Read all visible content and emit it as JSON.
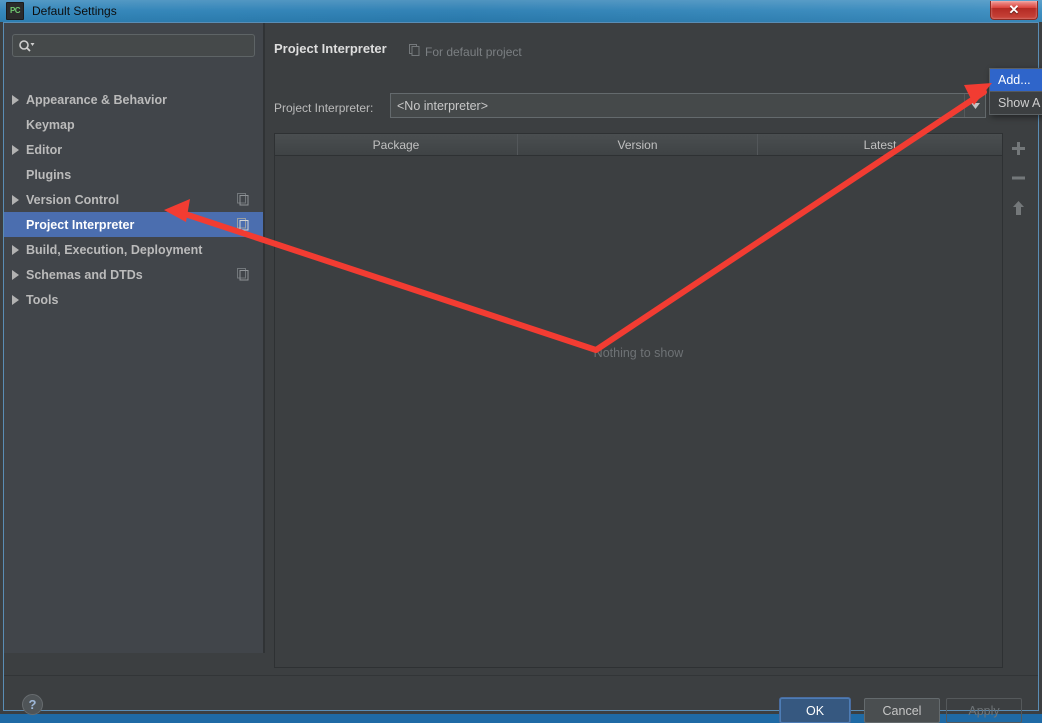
{
  "window": {
    "title": "Default Settings",
    "app_icon": "PC",
    "close_label": "✕"
  },
  "search": {
    "value": "",
    "placeholder": "",
    "icon": "search-icon"
  },
  "sidebar": {
    "items": [
      {
        "label": "Appearance & Behavior",
        "expandable": true,
        "selected": false,
        "has_copy_icon": false
      },
      {
        "label": "Keymap",
        "expandable": false,
        "selected": false,
        "has_copy_icon": false
      },
      {
        "label": "Editor",
        "expandable": true,
        "selected": false,
        "has_copy_icon": false
      },
      {
        "label": "Plugins",
        "expandable": false,
        "selected": false,
        "has_copy_icon": false
      },
      {
        "label": "Version Control",
        "expandable": true,
        "selected": false,
        "has_copy_icon": true
      },
      {
        "label": "Project Interpreter",
        "expandable": false,
        "selected": true,
        "has_copy_icon": true
      },
      {
        "label": "Build, Execution, Deployment",
        "expandable": true,
        "selected": false,
        "has_copy_icon": false
      },
      {
        "label": "Schemas and DTDs",
        "expandable": true,
        "selected": false,
        "has_copy_icon": true
      },
      {
        "label": "Tools",
        "expandable": true,
        "selected": false,
        "has_copy_icon": false
      }
    ]
  },
  "main": {
    "title": "Project Interpreter",
    "subtitle": "For default project",
    "subtitle_icon": "copy-icon",
    "interpreter_field_label": "Project Interpreter:",
    "interpreter_value": "<No interpreter>",
    "dropdown_icon": "chevron-down-icon",
    "table": {
      "columns": [
        "Package",
        "Version",
        "Latest"
      ],
      "rows": [],
      "empty_text": "Nothing to show"
    },
    "toolbar": [
      {
        "name": "add-package-button",
        "icon": "plus-icon"
      },
      {
        "name": "remove-package-button",
        "icon": "minus-icon"
      },
      {
        "name": "upgrade-package-button",
        "icon": "arrow-up-icon"
      }
    ]
  },
  "popup_menu": {
    "items": [
      {
        "label": "Add...",
        "highlighted": true
      },
      {
        "label": "Show A",
        "highlighted": false
      }
    ]
  },
  "bottom": {
    "help_label": "?",
    "ok_label": "OK",
    "cancel_label": "Cancel",
    "apply_label": "Apply"
  },
  "colors": {
    "accent_blue": "#4b6eaf",
    "ok_button": "#365880",
    "menu_highlight": "#2f65ca",
    "annotation_red": "#f23c32",
    "panel_bg": "#3c3f41",
    "sidebar_bg": "#41454a"
  }
}
